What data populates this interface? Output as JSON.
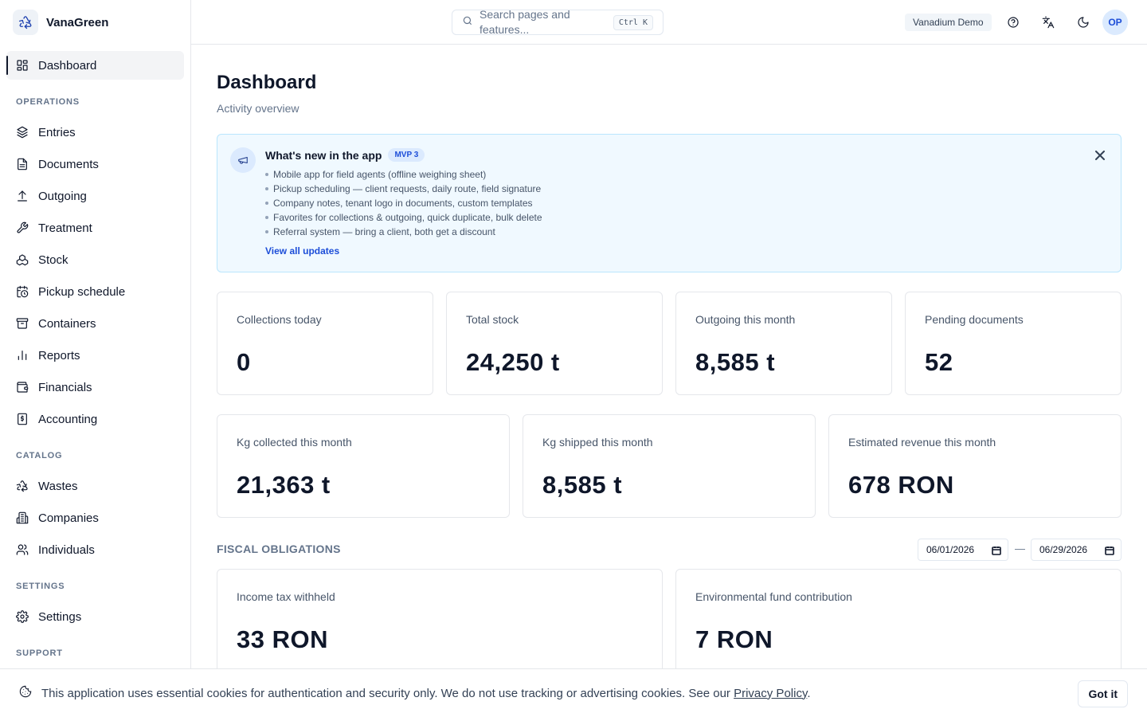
{
  "app": {
    "name": "VanaGreen"
  },
  "sidebar": {
    "dashboard": {
      "label": "Dashboard",
      "icon": "grid-icon"
    },
    "sections": [
      {
        "title": "OPERATIONS",
        "items": [
          {
            "label": "Entries",
            "icon": "layers-icon"
          },
          {
            "label": "Documents",
            "icon": "document-icon"
          },
          {
            "label": "Outgoing",
            "icon": "upload-icon"
          },
          {
            "label": "Treatment",
            "icon": "wrench-icon"
          },
          {
            "label": "Stock",
            "icon": "boxes-icon"
          },
          {
            "label": "Pickup schedule",
            "icon": "calendar-clock-icon"
          },
          {
            "label": "Containers",
            "icon": "archive-icon"
          },
          {
            "label": "Reports",
            "icon": "bar-chart-icon"
          },
          {
            "label": "Financials",
            "icon": "wallet-icon"
          },
          {
            "label": "Accounting",
            "icon": "receipt-icon"
          }
        ]
      },
      {
        "title": "CATALOG",
        "items": [
          {
            "label": "Wastes",
            "icon": "recycle-icon"
          },
          {
            "label": "Companies",
            "icon": "building-icon"
          },
          {
            "label": "Individuals",
            "icon": "users-icon"
          }
        ]
      },
      {
        "title": "SETTINGS",
        "items": [
          {
            "label": "Settings",
            "icon": "gear-icon"
          }
        ]
      },
      {
        "title": "SUPPORT",
        "items": []
      }
    ]
  },
  "topbar": {
    "search_placeholder": "Search pages and features...",
    "search_shortcut": "Ctrl K",
    "tenant": "Vanadium Demo",
    "avatar_initials": "OP"
  },
  "page": {
    "title": "Dashboard",
    "subtitle": "Activity overview"
  },
  "announcement": {
    "title": "What's new in the app",
    "badge": "MVP 3",
    "items": [
      "Mobile app for field agents (offline weighing sheet)",
      "Pickup scheduling — client requests, daily route, field signature",
      "Company notes, tenant logo in documents, custom templates",
      "Favorites for collections & outgoing, quick duplicate, bulk delete",
      "Referral system — bring a client, both get a discount"
    ],
    "link": "View all updates"
  },
  "stats_row1": [
    {
      "label": "Collections today",
      "value": "0"
    },
    {
      "label": "Total stock",
      "value": "24,250 t"
    },
    {
      "label": "Outgoing this month",
      "value": "8,585 t"
    },
    {
      "label": "Pending documents",
      "value": "52"
    }
  ],
  "stats_row2": [
    {
      "label": "Kg collected this month",
      "value": "21,363 t"
    },
    {
      "label": "Kg shipped this month",
      "value": "8,585 t"
    },
    {
      "label": "Estimated revenue this month",
      "value": "678 RON"
    }
  ],
  "fiscal": {
    "title": "FISCAL OBLIGATIONS",
    "date_from": "06/01/2026",
    "date_sep": "—",
    "date_to": "06/29/2026",
    "cards": [
      {
        "label": "Income tax withheld",
        "value": "33 RON"
      },
      {
        "label": "Environmental fund contribution",
        "value": "7 RON"
      }
    ]
  },
  "cookie": {
    "text": "This application uses essential cookies for authentication and security only. We do not use tracking or advertising cookies. See our ",
    "link": "Privacy Policy",
    "suffix": ".",
    "button": "Got it"
  }
}
